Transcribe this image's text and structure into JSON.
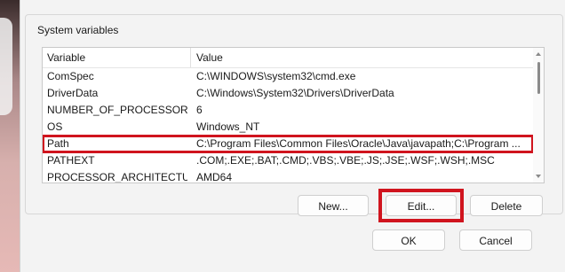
{
  "group": {
    "title": "System variables"
  },
  "table": {
    "columns": [
      "Variable",
      "Value"
    ],
    "rows": [
      {
        "variable": "ComSpec",
        "value": "C:\\WINDOWS\\system32\\cmd.exe"
      },
      {
        "variable": "DriverData",
        "value": "C:\\Windows\\System32\\Drivers\\DriverData"
      },
      {
        "variable": "NUMBER_OF_PROCESSORS",
        "value": "6"
      },
      {
        "variable": "OS",
        "value": "Windows_NT"
      },
      {
        "variable": "Path",
        "value": "C:\\Program Files\\Common Files\\Oracle\\Java\\javapath;C:\\Program ..."
      },
      {
        "variable": "PATHEXT",
        "value": ".COM;.EXE;.BAT;.CMD;.VBS;.VBE;.JS;.JSE;.WSF;.WSH;.MSC"
      },
      {
        "variable": "PROCESSOR_ARCHITECTURE",
        "value": "AMD64"
      }
    ],
    "highlighted_row": "Path"
  },
  "buttons": {
    "new": "New...",
    "edit": "Edit...",
    "delete": "Delete",
    "ok": "OK",
    "cancel": "Cancel"
  },
  "colors": {
    "highlight": "#d0141e",
    "dialog_bg": "#f3f3f3"
  }
}
